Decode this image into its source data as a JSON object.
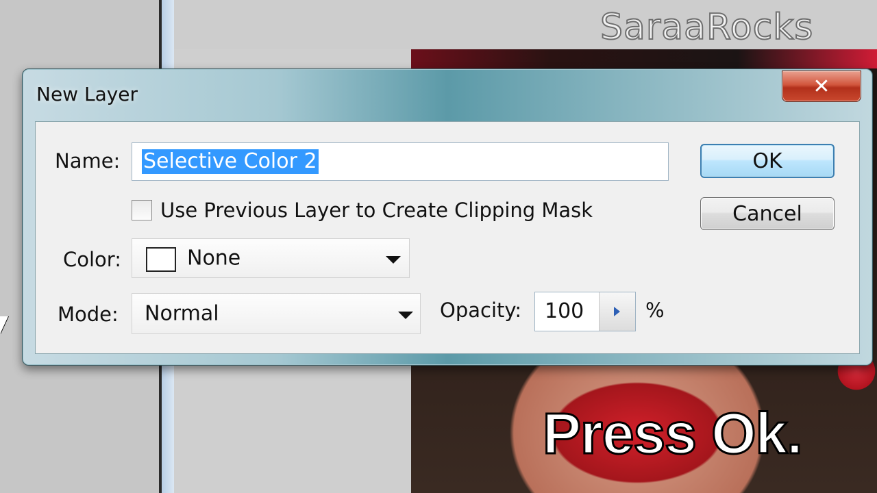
{
  "watermark": "SaraaRocks",
  "caption": "Press Ok.",
  "dialog": {
    "title": "New Layer",
    "close_symbol": "✕",
    "name_label": "Name:",
    "name_value": "Selective Color 2",
    "clipping_checkbox_label": "Use Previous Layer to Create Clipping Mask",
    "clipping_checked": false,
    "color_label": "Color:",
    "color_value": "None",
    "mode_label": "Mode:",
    "mode_value": "Normal",
    "opacity_label": "Opacity:",
    "opacity_value": "100",
    "opacity_unit": "%",
    "ok_label": "OK",
    "cancel_label": "Cancel"
  },
  "colors": {
    "selection": "#3399ff",
    "ok_border": "#3c7fb1",
    "close_button": "#c9482e"
  }
}
